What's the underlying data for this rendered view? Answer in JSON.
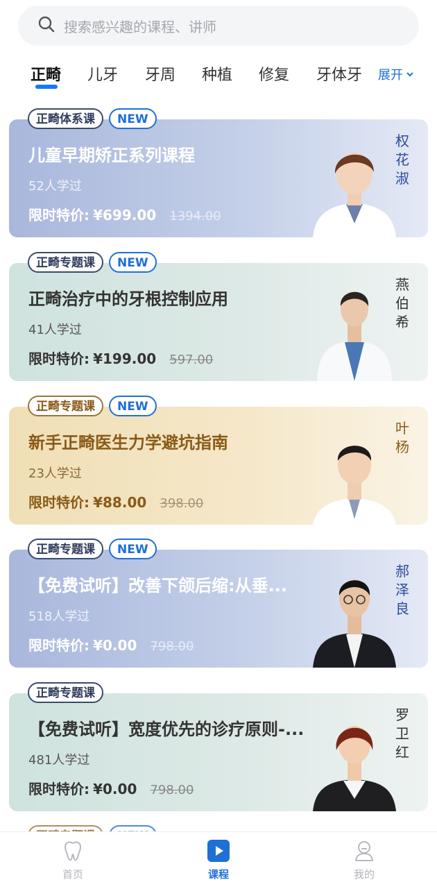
{
  "search": {
    "placeholder": "搜索感兴趣的课程、讲师",
    "icon": "search-icon"
  },
  "tabs": {
    "items": [
      {
        "label": "正畸"
      },
      {
        "label": "儿牙"
      },
      {
        "label": "牙周"
      },
      {
        "label": "种植"
      },
      {
        "label": "修复"
      },
      {
        "label": "牙体牙"
      }
    ],
    "active": "正畸",
    "expand_label": "展开",
    "accent": "#1677ff"
  },
  "courses": [
    {
      "category": "正畸体系课",
      "badge": "NEW",
      "title": "儿童早期矫正系列课程",
      "learners": "52人学过",
      "price_label": "限时特价:",
      "price": "¥699.00",
      "original_price": "1394.00",
      "teacher": "权花淑",
      "theme": "blue"
    },
    {
      "category": "正畸专题课",
      "badge": "NEW",
      "title": "正畸治疗中的牙根控制应用",
      "learners": "41人学过",
      "price_label": "限时特价:",
      "price": "¥199.00",
      "original_price": "597.00",
      "teacher": "燕伯希",
      "theme": "green"
    },
    {
      "category": "正畸专题课",
      "badge": "NEW",
      "title": "新手正畸医生力学避坑指南",
      "learners": "23人学过",
      "price_label": "限时特价:",
      "price": "¥88.00",
      "original_price": "398.00",
      "teacher": "叶杨",
      "theme": "gold"
    },
    {
      "category": "正畸专题课",
      "badge": "NEW",
      "title": "【免费试听】改善下颌后缩:从垂...",
      "learners": "518人学过",
      "price_label": "限时特价:",
      "price": "¥0.00",
      "original_price": "798.00",
      "teacher": "郝泽良",
      "theme": "blue"
    },
    {
      "category": "正畸专题课",
      "badge": "",
      "title": "【免费试听】宽度优先的诊疗原则-...",
      "learners": "481人学过",
      "price_label": "限时特价:",
      "price": "¥0.00",
      "original_price": "798.00",
      "teacher": "罗卫红",
      "theme": "green"
    }
  ],
  "partial_next": {
    "category": "正畸专题课",
    "badge": "NEW"
  },
  "bottom_nav": [
    {
      "label": "首页",
      "icon": "tooth-icon",
      "active": false
    },
    {
      "label": "课程",
      "icon": "play-icon",
      "active": true
    },
    {
      "label": "我的",
      "icon": "profile-icon",
      "active": false
    }
  ],
  "colors": {
    "accent": "#1f6fd6",
    "blue_card": "#a9b7dc",
    "green_card": "#cfe3de",
    "gold_card": "#f0dfb6"
  }
}
